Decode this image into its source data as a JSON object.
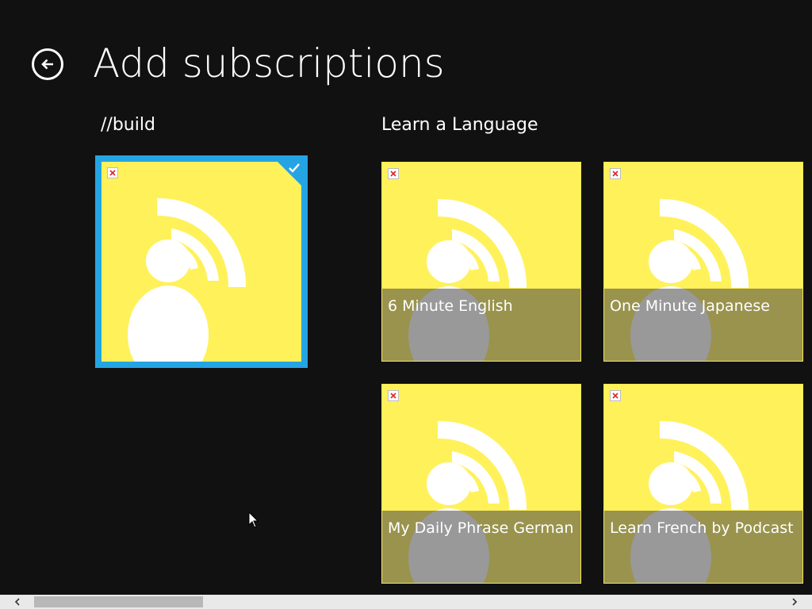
{
  "page": {
    "title": "Add subscriptions",
    "back_icon": "back-arrow-icon"
  },
  "groups": [
    {
      "header": "//build",
      "tiles": [
        {
          "label": "",
          "selected": true
        }
      ]
    },
    {
      "header": "Learn a Language",
      "tiles": [
        {
          "label": "6 Minute English",
          "selected": false
        },
        {
          "label": "One Minute Japanese",
          "selected": false
        },
        {
          "label": "My Daily Phrase German",
          "selected": false
        },
        {
          "label": "Learn French by Podcast",
          "selected": false
        }
      ]
    }
  ],
  "colors": {
    "background": "#111111",
    "tile": "#fff15a",
    "accent": "#25a4e4"
  },
  "icons": {
    "tile_image": "podcast-icon",
    "broken_image": "broken-image-icon",
    "selection": "checkmark-icon"
  }
}
